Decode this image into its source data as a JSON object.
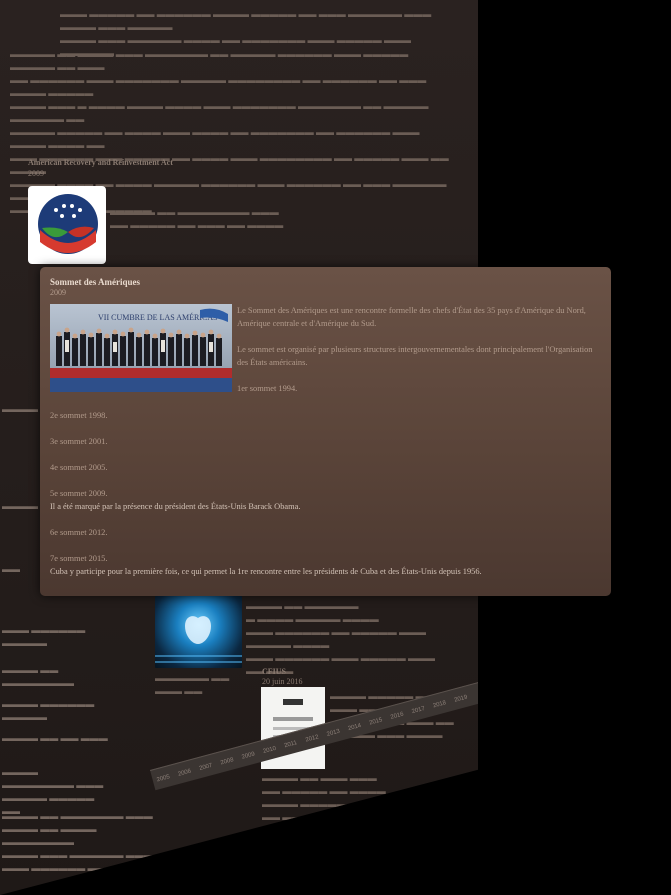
{
  "background": {
    "section_title": "American Recovery and Reinvestment Act",
    "section_year": "2009",
    "doc_title": "CFIUS",
    "doc_year": "20 juin 2016",
    "timeline_years": [
      "2005",
      "2006",
      "2007",
      "2008",
      "2009",
      "2010",
      "2011",
      "2012",
      "2013",
      "2014",
      "2015",
      "2016",
      "2017",
      "2018",
      "2019"
    ]
  },
  "card": {
    "title": "Sommet des Amériques",
    "year": "2009",
    "photo_banner": "VII CUMBRE DE LAS AMÉRICAS",
    "intro": "Le Sommet des Amériques est une rencontre formelle des chefs d'État des 35 pays d'Amérique du Nord, Amérique centrale et d'Amérique du Sud.",
    "structure": "Le sommet est organisé par plusieurs structures intergouvernementales dont principalement l'Organisation des États américains.",
    "first": "1er sommet 1994.",
    "summits": [
      {
        "label": "2e sommet 1998.",
        "desc": ""
      },
      {
        "label": "3e sommet 2001.",
        "desc": ""
      },
      {
        "label": "4e sommet 2005.",
        "desc": ""
      },
      {
        "label": "5e sommet 2009.",
        "desc": "Il a été marqué par la présence du président des États-Unis Barack Obama."
      },
      {
        "label": "6e sommet 2012.",
        "desc": ""
      },
      {
        "label": "7e sommet 2015.",
        "desc": "Cuba y participe pour la première fois, ce qui permet la 1re rencontre entre les présidents de Cuba et des États-Unis depuis 1956."
      }
    ]
  }
}
